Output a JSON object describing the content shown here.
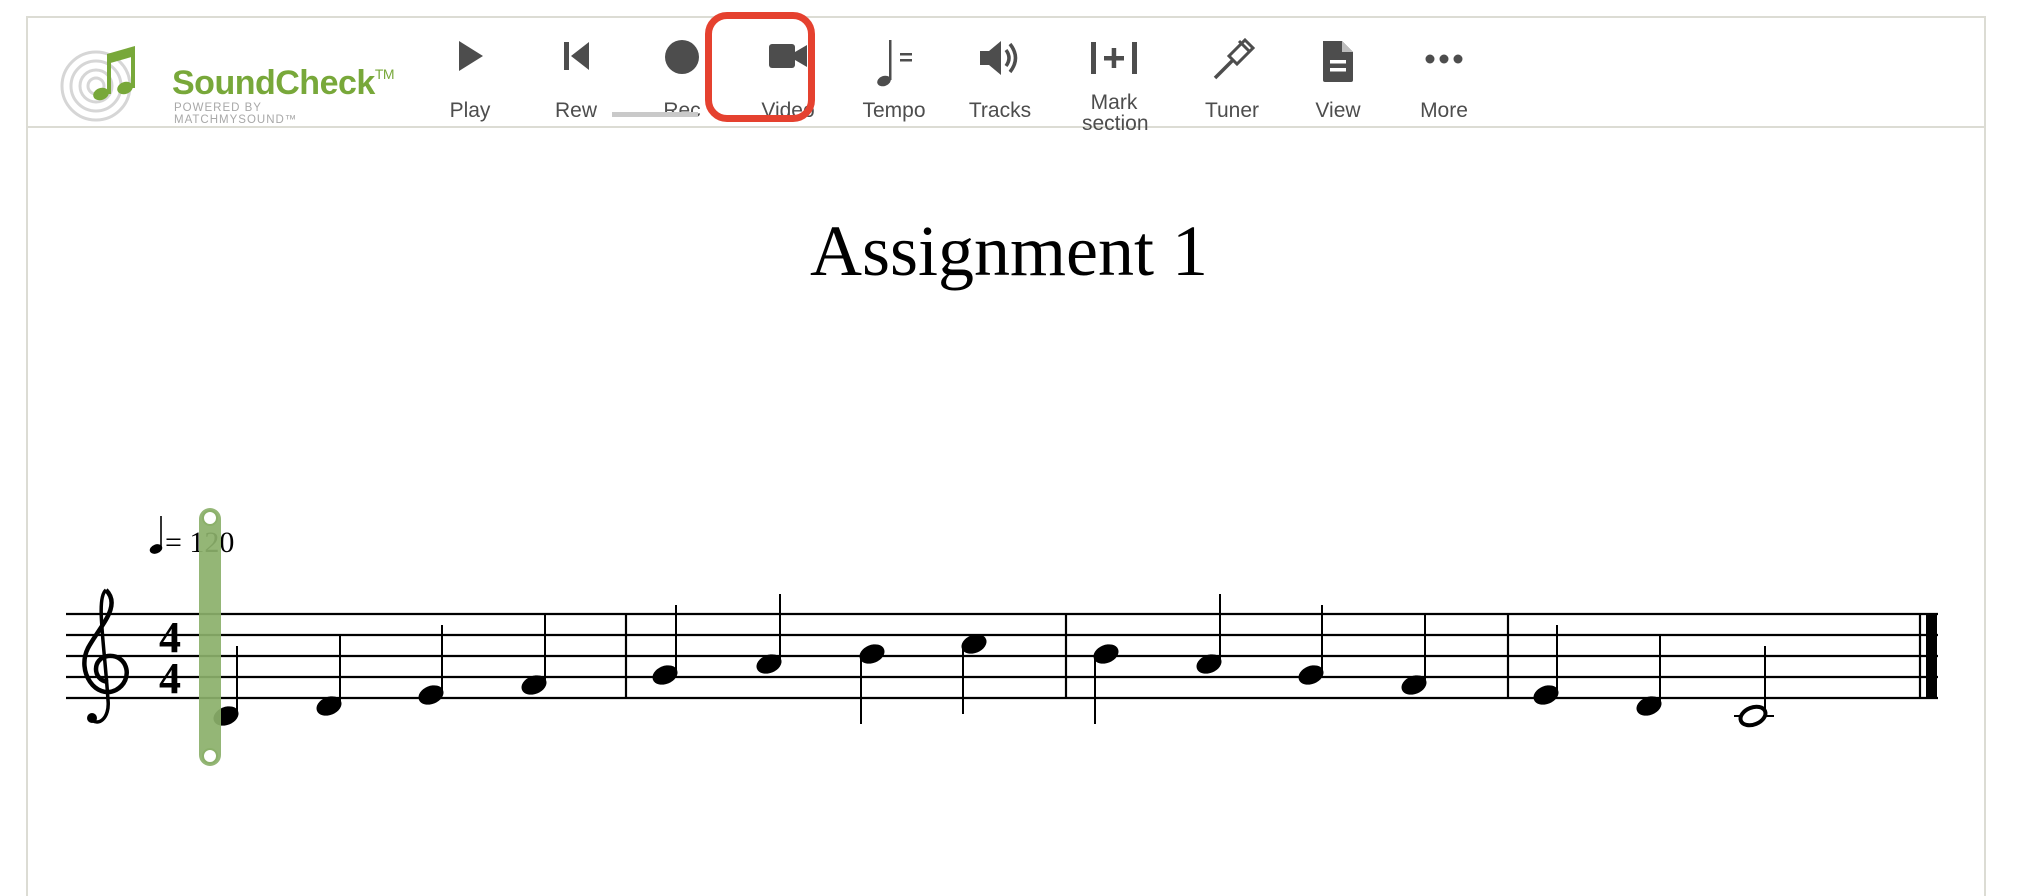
{
  "app": {
    "brand_name": "SoundCheck",
    "brand_tm": "TM",
    "brand_sub": "POWERED BY MATCHMYSOUND™"
  },
  "toolbar": {
    "items": [
      {
        "label": "Play",
        "icon": "play-icon"
      },
      {
        "label": "Rew",
        "icon": "rewind-icon"
      },
      {
        "label": "Rec",
        "icon": "record-icon"
      },
      {
        "label": "Video",
        "icon": "video-camera-icon"
      },
      {
        "label": "Tempo",
        "icon": "tempo-note-icon"
      },
      {
        "label": "Tracks",
        "icon": "speaker-icon"
      },
      {
        "label": "Mark section",
        "icon": "mark-section-icon"
      },
      {
        "label": "Tuner",
        "icon": "tuning-fork-icon"
      },
      {
        "label": "View",
        "icon": "document-icon"
      },
      {
        "label": "More",
        "icon": "more-dots-icon"
      }
    ],
    "active_item": "Rec",
    "highlighted_item": "Video"
  },
  "score": {
    "title": "Assignment 1",
    "tempo_text": "= 120",
    "time_signature": {
      "top": "4",
      "bottom": "4"
    },
    "clef": "treble-clef-icon"
  },
  "colors": {
    "brand_green": "#78a83a",
    "highlight_red": "#e5412f",
    "cursor_green": "#8bb06a",
    "icon_gray": "#4d4d4d"
  }
}
